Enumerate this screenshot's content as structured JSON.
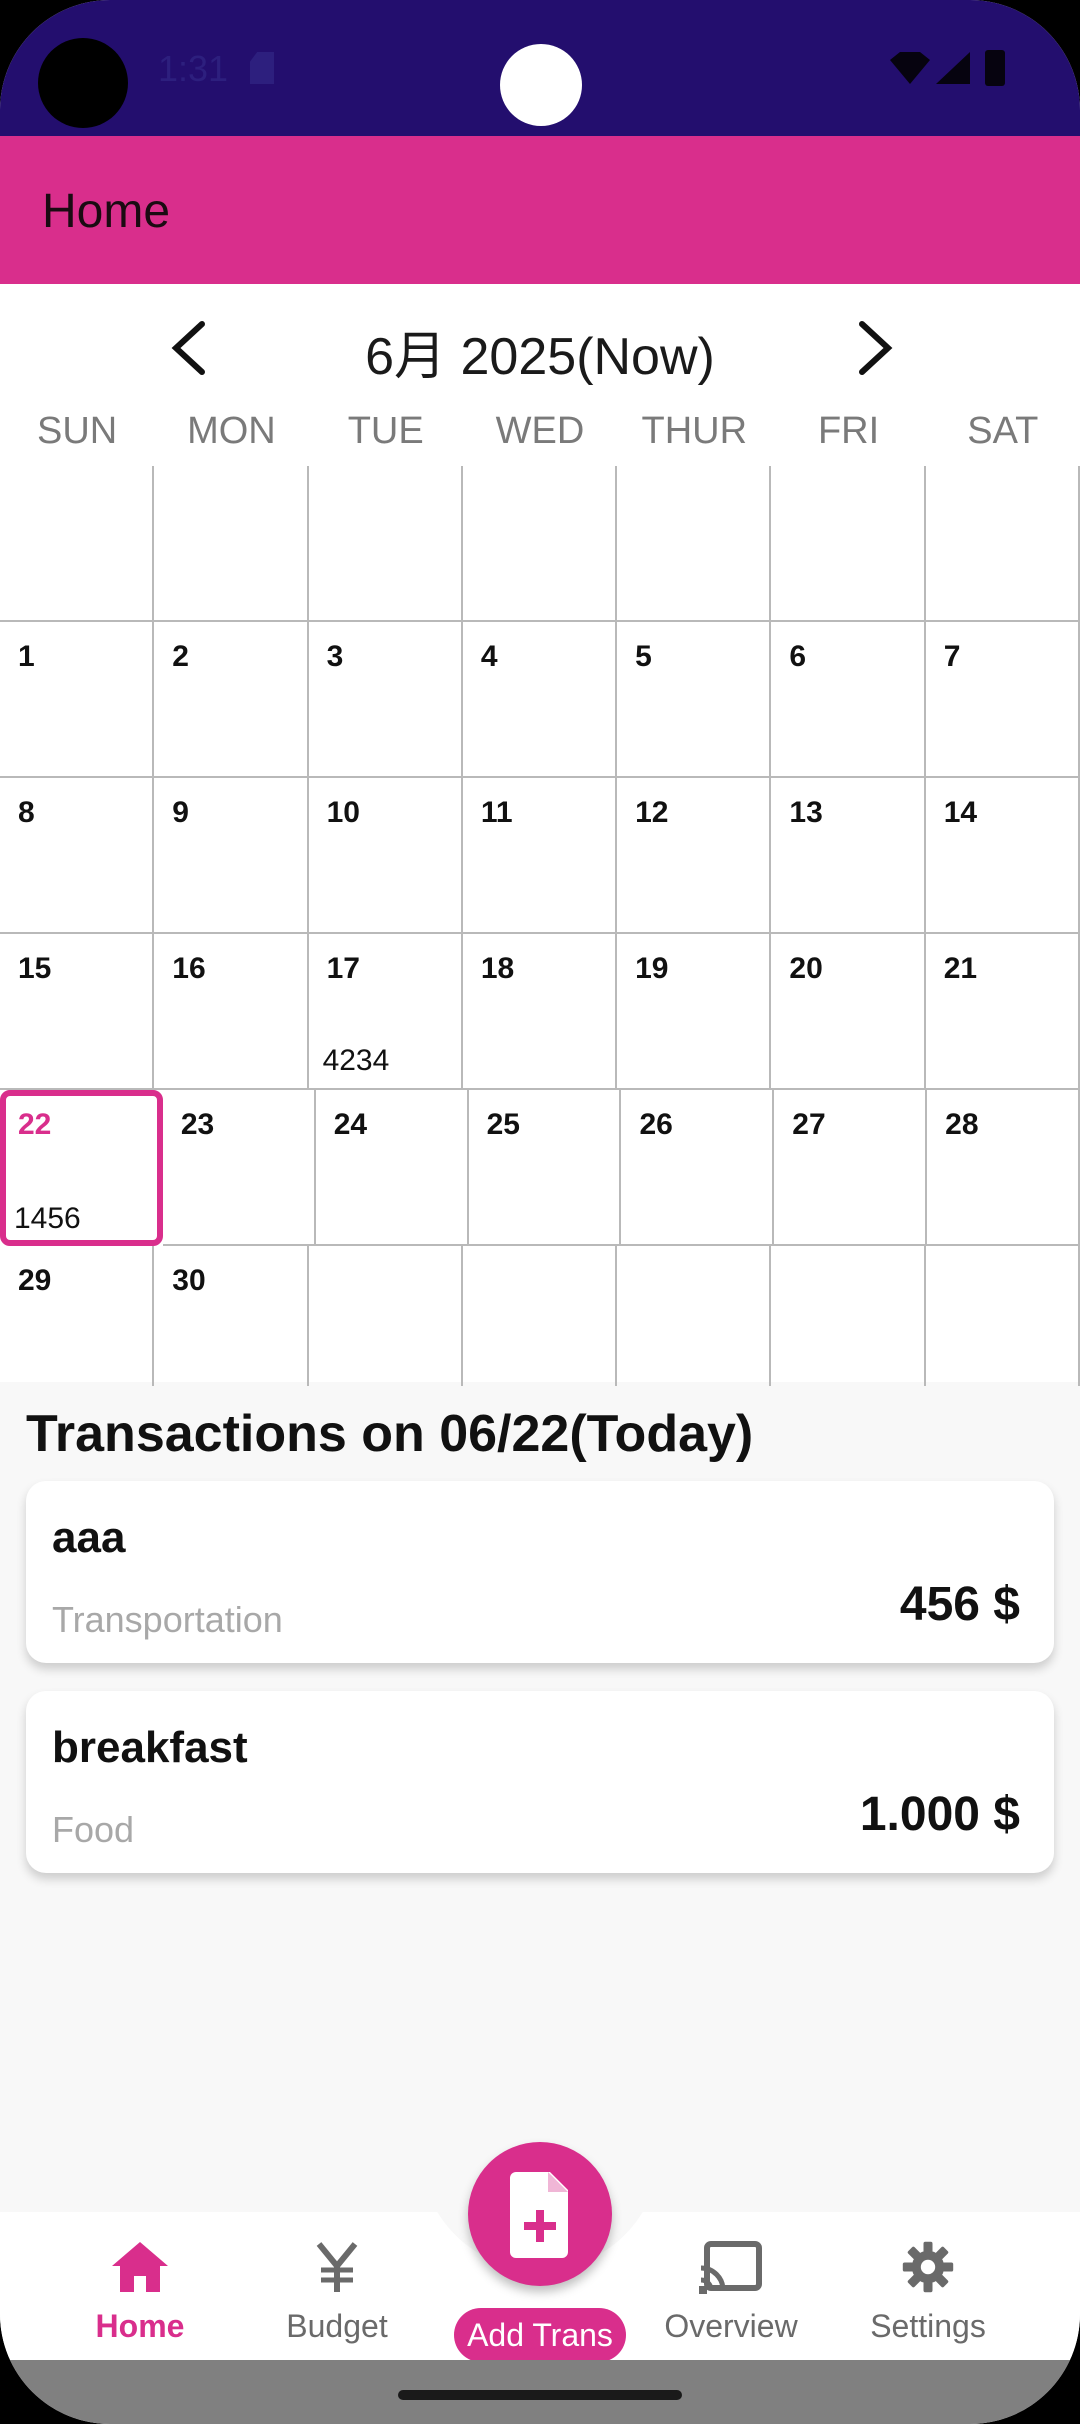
{
  "status_bar": {
    "time": "1:31"
  },
  "app_bar": {
    "title": "Home"
  },
  "calendar": {
    "month_title": "6月 2025(Now)",
    "weekdays": [
      "SUN",
      "MON",
      "TUE",
      "WED",
      "THUR",
      "FRI",
      "SAT"
    ],
    "weeks": [
      [
        {
          "day": ""
        },
        {
          "day": ""
        },
        {
          "day": ""
        },
        {
          "day": ""
        },
        {
          "day": ""
        },
        {
          "day": ""
        },
        {
          "day": ""
        }
      ],
      [
        {
          "day": "1"
        },
        {
          "day": "2"
        },
        {
          "day": "3"
        },
        {
          "day": "4"
        },
        {
          "day": "5"
        },
        {
          "day": "6"
        },
        {
          "day": "7"
        }
      ],
      [
        {
          "day": "8"
        },
        {
          "day": "9"
        },
        {
          "day": "10"
        },
        {
          "day": "11"
        },
        {
          "day": "12"
        },
        {
          "day": "13"
        },
        {
          "day": "14"
        }
      ],
      [
        {
          "day": "15"
        },
        {
          "day": "16"
        },
        {
          "day": "17",
          "amount": "4234"
        },
        {
          "day": "18"
        },
        {
          "day": "19"
        },
        {
          "day": "20"
        },
        {
          "day": "21"
        }
      ],
      [
        {
          "day": "22",
          "amount": "1456",
          "selected": true
        },
        {
          "day": "23"
        },
        {
          "day": "24"
        },
        {
          "day": "25"
        },
        {
          "day": "26"
        },
        {
          "day": "27"
        },
        {
          "day": "28"
        }
      ],
      [
        {
          "day": "29"
        },
        {
          "day": "30"
        },
        {
          "day": ""
        },
        {
          "day": ""
        },
        {
          "day": ""
        },
        {
          "day": ""
        },
        {
          "day": ""
        }
      ]
    ]
  },
  "transactions": {
    "heading": "Transactions on 06/22(Today)",
    "items": [
      {
        "name": "aaa",
        "category": "Transportation",
        "amount": "456 $"
      },
      {
        "name": "breakfast",
        "category": "Food",
        "amount": "1.000 $"
      }
    ]
  },
  "bottom_nav": {
    "items": [
      {
        "label": "Home",
        "icon": "home-icon",
        "active": true
      },
      {
        "label": "Budget",
        "icon": "yen-icon",
        "active": false
      },
      {
        "label": "Overview",
        "icon": "cast-icon",
        "active": false
      },
      {
        "label": "Settings",
        "icon": "gear-icon",
        "active": false
      }
    ],
    "fab_label": "Add Trans",
    "fab_icon": "add-file-icon"
  },
  "colors": {
    "accent": "#d92e8c",
    "status_bar": "#230e6e"
  }
}
